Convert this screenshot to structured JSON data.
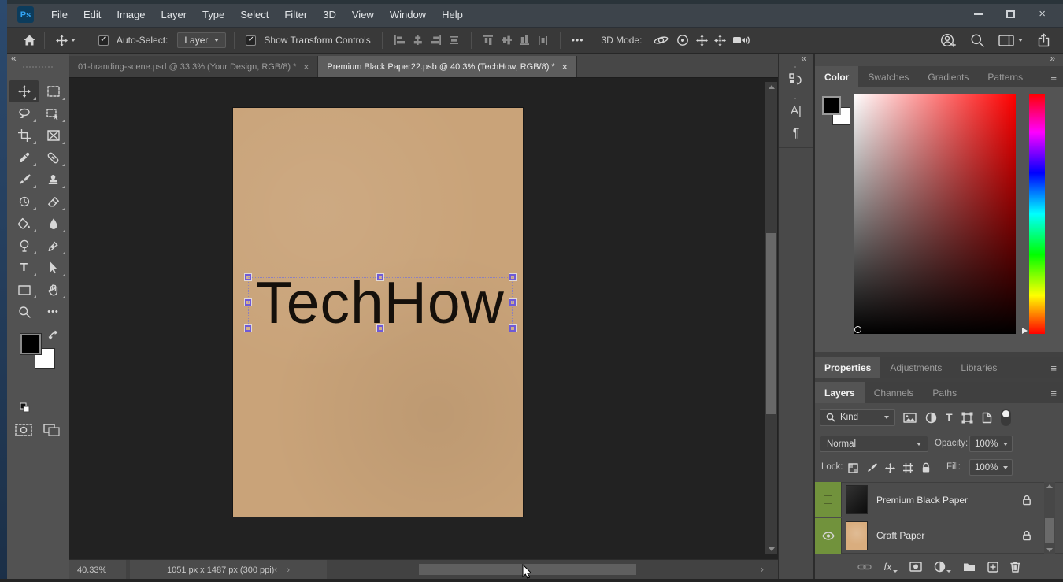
{
  "titlebar": {
    "logo": "Ps",
    "menus": [
      "File",
      "Edit",
      "Image",
      "Layer",
      "Type",
      "Select",
      "Filter",
      "3D",
      "View",
      "Window",
      "Help"
    ]
  },
  "options_bar": {
    "auto_select_label": "Auto-Select:",
    "auto_select_value": "Layer",
    "show_transform_label": "Show Transform Controls",
    "mode_label": "3D Mode:"
  },
  "document_tabs": [
    {
      "label": "01-branding-scene.psd @ 33.3% (Your Design, RGB/8) *",
      "active": false
    },
    {
      "label": "Premium Black Paper22.psb @ 40.3% (TechHow, RGB/8) *",
      "active": true
    }
  ],
  "canvas": {
    "logo_text": "TechHow",
    "paper_color": "#c9a379"
  },
  "color_panel": {
    "tabs": [
      "Color",
      "Swatches",
      "Gradients",
      "Patterns"
    ]
  },
  "properties_panel": {
    "tabs": [
      "Properties",
      "Adjustments",
      "Libraries"
    ]
  },
  "layers_panel": {
    "tabs": [
      "Layers",
      "Channels",
      "Paths"
    ],
    "filter_kind": "Kind",
    "blend_mode": "Normal",
    "opacity_label": "Opacity:",
    "opacity_value": "100%",
    "lock_label": "Lock:",
    "fill_label": "Fill:",
    "fill_value": "100%",
    "layers": [
      {
        "name": "Premium Black Paper",
        "visible": false,
        "locked": true,
        "color_label": "green",
        "thumb_color": "#161616"
      },
      {
        "name": "Craft Paper",
        "visible": true,
        "locked": true,
        "color_label": "green",
        "thumb_color": "#d9ad7e"
      }
    ]
  },
  "status_bar": {
    "zoom_level": "40.33%",
    "doc_info": "1051 px x 1487 px (300 ppi)"
  },
  "glyphs": {
    "check": "✓",
    "close": "×",
    "menu": "≡",
    "collapse_left": "«",
    "collapse_right": "»",
    "scroll_left": "‹",
    "scroll_right": "›",
    "type_tool": "T",
    "more": "•••",
    "character_panel": "A|",
    "paragraph_panel": "¶",
    "fx": "fx"
  },
  "colors": {
    "label_green": "#71923c",
    "handle_purple": "#6f5ad6",
    "ps_logo_blue": "#33a5f5",
    "paper": "#c9a379",
    "titlebar": "#3d444b"
  }
}
